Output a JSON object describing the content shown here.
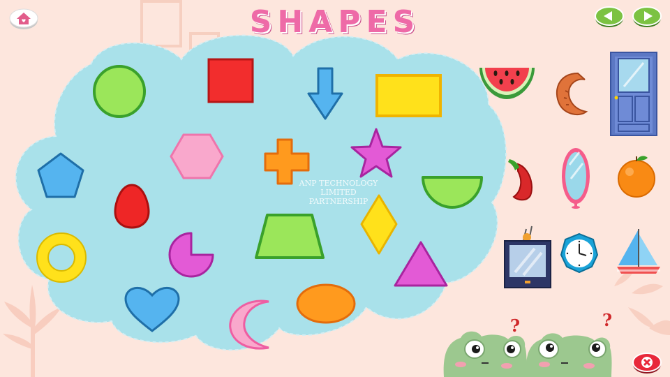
{
  "title": "SHAPES",
  "watermark": {
    "line1": "ANP TECHNOLOGY",
    "line2": "LIMITED PARTNERSHIP"
  },
  "colors": {
    "background": "#fde6dd",
    "cloud": "#a9e1ea",
    "title": "#ee6aa7",
    "nav_button": "#7cc242",
    "close_button": "#e8283a"
  },
  "buttons": {
    "home": "home-icon",
    "prev": "arrow-left-icon",
    "next": "arrow-right-icon",
    "close": "close-icon"
  },
  "shapes": [
    "circle",
    "square",
    "arrow",
    "rectangle",
    "pentagon",
    "hexagon",
    "cross",
    "star",
    "oval-egg",
    "semicircle",
    "ring",
    "trapezoid",
    "diamond",
    "pacman",
    "triangle",
    "heart",
    "crescent",
    "ellipse"
  ],
  "objects": [
    "watermelon",
    "sausage",
    "door",
    "chili-pepper",
    "mirror",
    "orange",
    "television",
    "clock",
    "sailboat"
  ],
  "mascots": [
    "frog-left",
    "frog-right"
  ],
  "question_mark": "?"
}
